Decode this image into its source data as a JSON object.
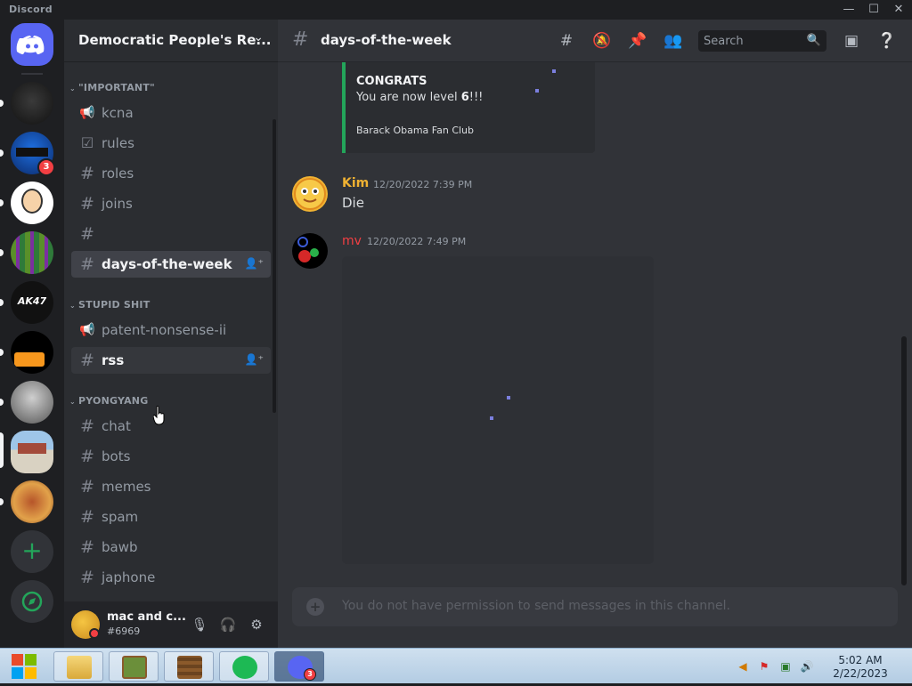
{
  "window": {
    "app_name": "Discord"
  },
  "guild": {
    "name": "Democratic People's Re..."
  },
  "server_rail": {
    "unread_badge": "3"
  },
  "sidebar": {
    "categories": [
      {
        "label": "\"IMPORTANT\""
      },
      {
        "label": "STUPID SHIT"
      },
      {
        "label": "PYONGYANG"
      }
    ],
    "channels": [
      {
        "name": "kcna",
        "icon": "megaphone-icon"
      },
      {
        "name": "rules",
        "icon": "checkbox-icon"
      },
      {
        "name": "roles",
        "icon": "hash-icon"
      },
      {
        "name": "joins",
        "icon": "hash-icon"
      },
      {
        "name": "",
        "icon": "hash-icon"
      },
      {
        "name": "days-of-the-week",
        "icon": "hash-icon",
        "active": true
      },
      {
        "name": "patent-nonsense-ii",
        "icon": "megaphone-icon"
      },
      {
        "name": "rss",
        "icon": "hash-icon",
        "unread": true
      },
      {
        "name": "chat",
        "icon": "hash-icon"
      },
      {
        "name": "bots",
        "icon": "hash-icon"
      },
      {
        "name": "memes",
        "icon": "hash-icon"
      },
      {
        "name": "spam",
        "icon": "hash-icon"
      },
      {
        "name": "bawb",
        "icon": "hash-icon"
      },
      {
        "name": "japhone",
        "icon": "hash-icon"
      }
    ]
  },
  "user_panel": {
    "username": "mac and c...",
    "tag": "#6969"
  },
  "channel_header": {
    "title": "days-of-the-week",
    "search_placeholder": "Search"
  },
  "embed": {
    "heading": "CONGRATS",
    "body_prefix": "You are now level ",
    "level": "6",
    "body_suffix": "!!!",
    "footer": "Barack Obama Fan Club"
  },
  "messages": [
    {
      "author": "Kim",
      "timestamp": "12/20/2022 7:39 PM",
      "text": "Die",
      "color": "#f0b232"
    },
    {
      "author": "mv",
      "timestamp": "12/20/2022 7:49 PM",
      "text": "",
      "color": "#f23f43"
    }
  ],
  "composer": {
    "text": "You do not have permission to send messages in this channel."
  },
  "taskbar": {
    "time": "5:02 AM",
    "date": "2/22/2023",
    "discord_badge": "3"
  },
  "colors": {
    "accent_green": "#23a55a",
    "badge_red": "#f23f43",
    "blurple": "#5865f2"
  }
}
